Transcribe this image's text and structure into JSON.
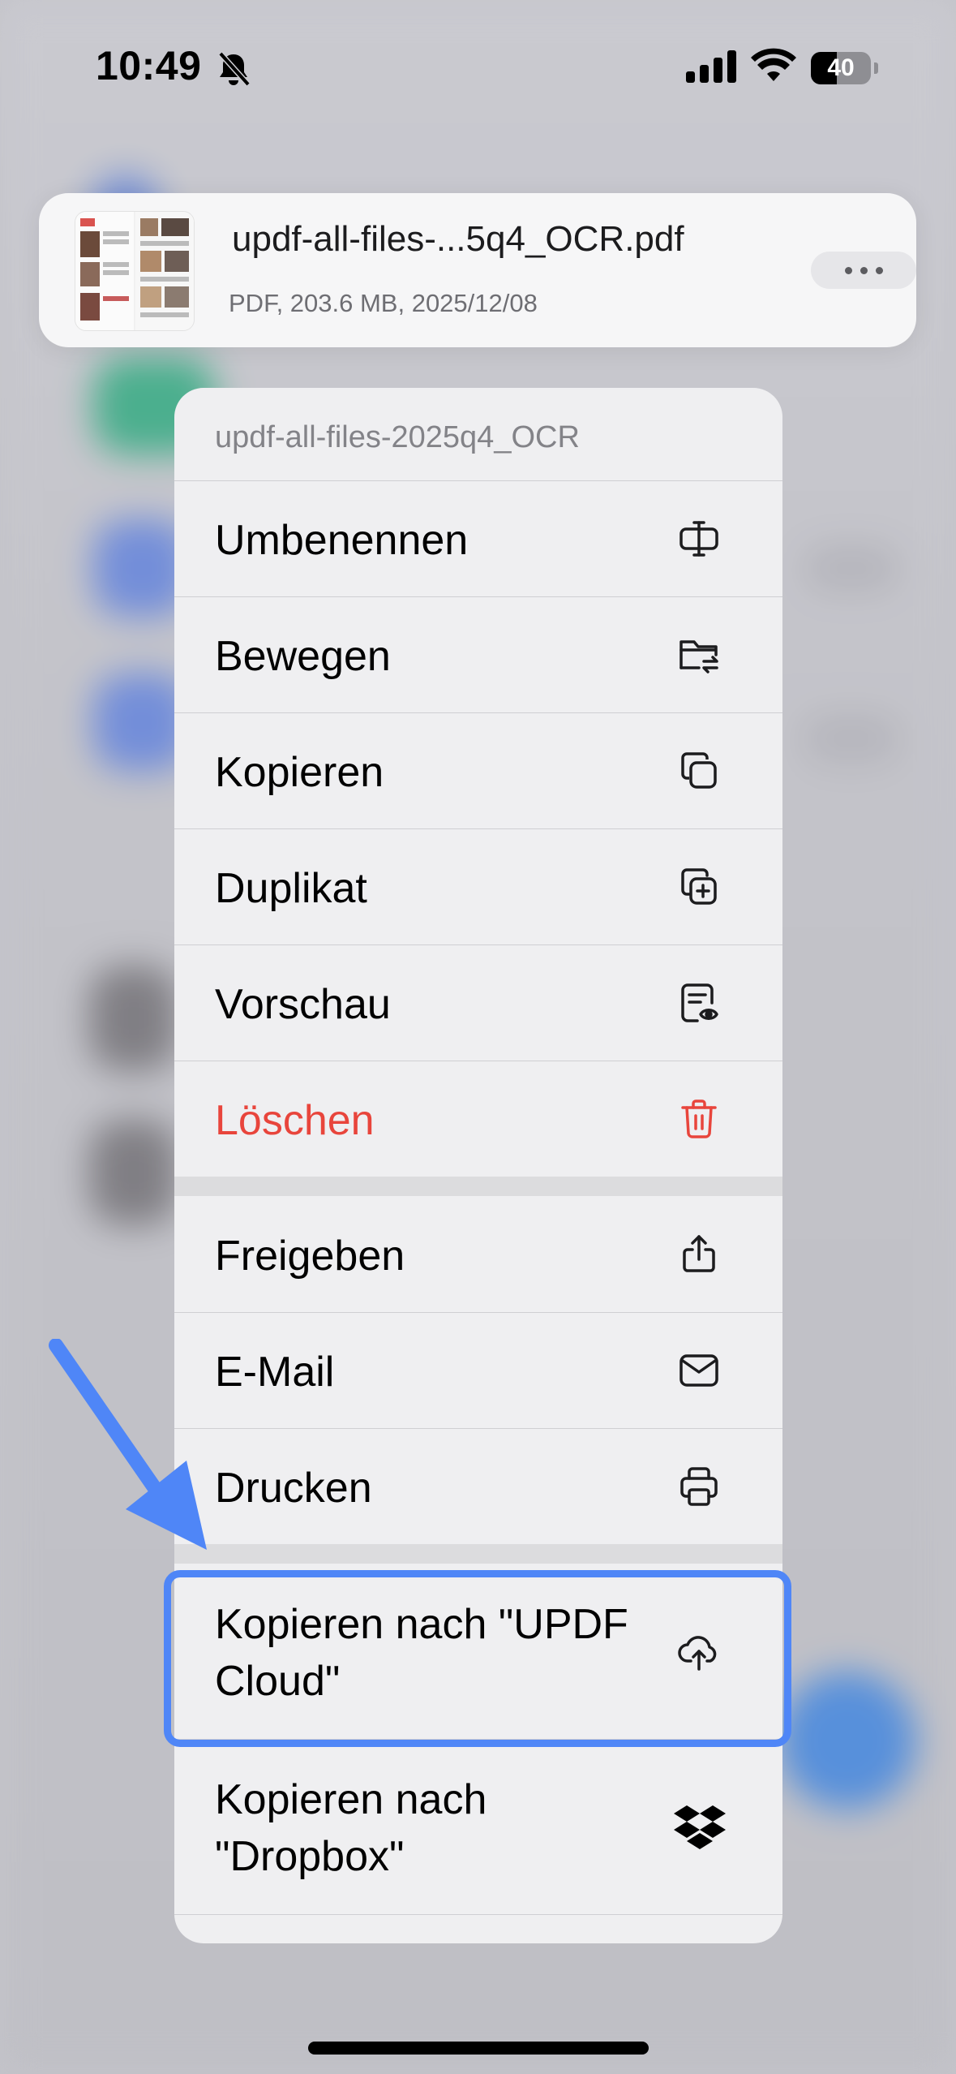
{
  "status_bar": {
    "time": "10:49",
    "battery": "40",
    "icons": [
      "bell-slash-icon",
      "signal-icon",
      "wifi-icon",
      "battery-icon"
    ]
  },
  "file": {
    "name": "updf-all-files-...5q4_OCR.pdf",
    "meta": "PDF, 203.6 MB, 2025/12/08",
    "more_icon": "ellipsis-icon"
  },
  "menu": {
    "header": "updf-all-files-2025q4_OCR",
    "items": [
      {
        "label": "Umbenennen",
        "icon": "rename-icon"
      },
      {
        "label": "Bewegen",
        "icon": "folder-move-icon"
      },
      {
        "label": "Kopieren",
        "icon": "copy-icon"
      },
      {
        "label": "Duplikat",
        "icon": "duplicate-icon"
      },
      {
        "label": "Vorschau",
        "icon": "preview-icon"
      },
      {
        "label": "Löschen",
        "icon": "trash-icon",
        "color": "#e8453c"
      },
      {
        "label": "Freigeben",
        "icon": "share-icon"
      },
      {
        "label": "E-Mail",
        "icon": "mail-icon"
      },
      {
        "label": "Drucken",
        "icon": "printer-icon"
      },
      {
        "label": "Kopieren nach \"UPDF Cloud\"",
        "icon": "cloud-upload-icon",
        "highlighted": true
      },
      {
        "label": "Kopieren nach \"Dropbox\"",
        "icon": "dropbox-icon"
      }
    ]
  },
  "colors": {
    "highlight": "#4f86f7",
    "destructive": "#e8453c",
    "menu_bg": "#efeff1"
  }
}
